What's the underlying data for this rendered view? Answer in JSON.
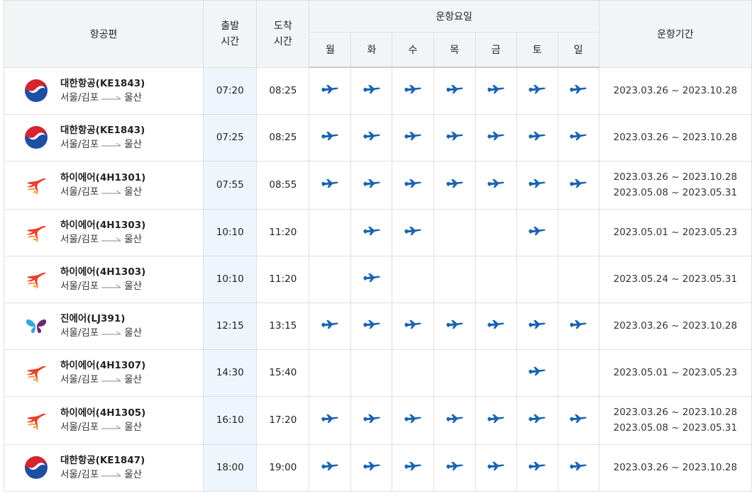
{
  "headers": {
    "flight": "항공편",
    "departure": "출발\n시간",
    "arrival": "도착\n시간",
    "operating_days": "운항요일",
    "period": "운항기간",
    "days": [
      "월",
      "화",
      "수",
      "목",
      "금",
      "토",
      "일"
    ]
  },
  "rows": [
    {
      "airline": "korean-air",
      "flight": "대한항공(KE1843)",
      "route_from": "서울/김포",
      "route_to": "울산",
      "dep": "07:20",
      "arr": "08:25",
      "days": [
        1,
        1,
        1,
        1,
        1,
        1,
        1
      ],
      "periods": [
        "2023.03.26 ~ 2023.10.28"
      ]
    },
    {
      "airline": "korean-air",
      "flight": "대한항공(KE1843)",
      "route_from": "서울/김포",
      "route_to": "울산",
      "dep": "07:25",
      "arr": "08:25",
      "days": [
        1,
        1,
        1,
        1,
        1,
        1,
        1
      ],
      "periods": [
        "2023.03.26 ~ 2023.10.28"
      ]
    },
    {
      "airline": "hi-air",
      "flight": "하이에어(4H1301)",
      "route_from": "서울/김포",
      "route_to": "울산",
      "dep": "07:55",
      "arr": "08:55",
      "days": [
        1,
        1,
        1,
        1,
        1,
        1,
        1
      ],
      "periods": [
        "2023.03.26 ~ 2023.10.28",
        "2023.05.08 ~ 2023.05.31"
      ]
    },
    {
      "airline": "hi-air",
      "flight": "하이에어(4H1303)",
      "route_from": "서울/김포",
      "route_to": "울산",
      "dep": "10:10",
      "arr": "11:20",
      "days": [
        0,
        1,
        1,
        0,
        0,
        1,
        0
      ],
      "periods": [
        "2023.05.01 ~ 2023.05.23"
      ]
    },
    {
      "airline": "hi-air",
      "flight": "하이에어(4H1303)",
      "route_from": "서울/김포",
      "route_to": "울산",
      "dep": "10:10",
      "arr": "11:20",
      "days": [
        0,
        1,
        0,
        0,
        0,
        0,
        0
      ],
      "periods": [
        "2023.05.24 ~ 2023.05.31"
      ]
    },
    {
      "airline": "jin-air",
      "flight": "진에어(LJ391)",
      "route_from": "서울/김포",
      "route_to": "울산",
      "dep": "12:15",
      "arr": "13:15",
      "days": [
        1,
        1,
        1,
        1,
        1,
        1,
        1
      ],
      "periods": [
        "2023.03.26 ~ 2023.10.28"
      ]
    },
    {
      "airline": "hi-air",
      "flight": "하이에어(4H1307)",
      "route_from": "서울/김포",
      "route_to": "울산",
      "dep": "14:30",
      "arr": "15:40",
      "days": [
        0,
        0,
        0,
        0,
        0,
        1,
        0
      ],
      "periods": [
        "2023.05.01 ~ 2023.05.23"
      ]
    },
    {
      "airline": "hi-air",
      "flight": "하이에어(4H1305)",
      "route_from": "서울/김포",
      "route_to": "울산",
      "dep": "16:10",
      "arr": "17:20",
      "days": [
        1,
        1,
        1,
        1,
        1,
        1,
        1
      ],
      "periods": [
        "2023.03.26 ~ 2023.10.28",
        "2023.05.08 ~ 2023.05.31"
      ]
    },
    {
      "airline": "korean-air",
      "flight": "대한항공(KE1847)",
      "route_from": "서울/김포",
      "route_to": "울산",
      "dep": "18:00",
      "arr": "19:00",
      "days": [
        1,
        1,
        1,
        1,
        1,
        1,
        1
      ],
      "periods": [
        "2023.03.26 ~ 2023.10.28"
      ]
    }
  ],
  "icons": {
    "plane": "plane-icon",
    "korean-air": "korean-air-logo",
    "hi-air": "hi-air-logo",
    "jin-air": "jin-air-logo"
  },
  "colors": {
    "plane": "#1a63b0",
    "dep_column_bg": "#eef5fc",
    "header_bg": "#f3f4f6"
  }
}
